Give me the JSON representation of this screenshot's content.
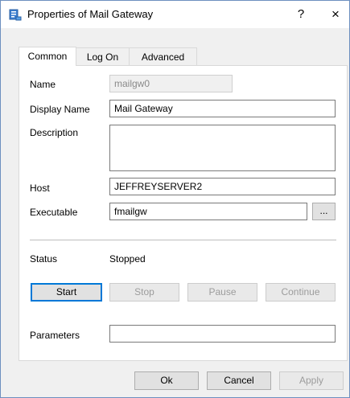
{
  "window": {
    "title": "Properties of Mail Gateway",
    "help": "?",
    "close": "×"
  },
  "tabs": [
    {
      "label": "Common"
    },
    {
      "label": "Log On"
    },
    {
      "label": "Advanced"
    }
  ],
  "form": {
    "name_label": "Name",
    "name_value": "mailgw0",
    "display_name_label": "Display Name",
    "display_name_value": "Mail Gateway",
    "description_label": "Description",
    "description_value": "",
    "host_label": "Host",
    "host_value": "JEFFREYSERVER2",
    "executable_label": "Executable",
    "executable_value": "fmailgw",
    "browse_label": "...",
    "status_label": "Status",
    "status_value": "Stopped",
    "parameters_label": "Parameters",
    "parameters_value": ""
  },
  "service_buttons": {
    "start": "Start",
    "stop": "Stop",
    "pause": "Pause",
    "continue": "Continue"
  },
  "footer": {
    "ok": "Ok",
    "cancel": "Cancel",
    "apply": "Apply"
  }
}
